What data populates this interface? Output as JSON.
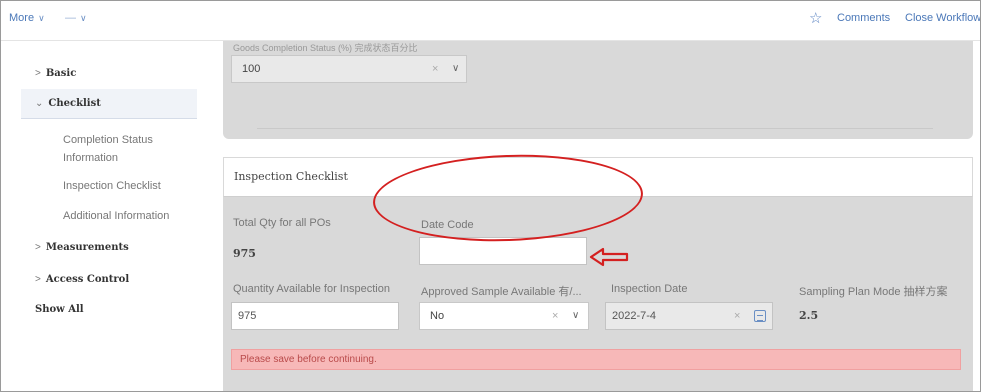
{
  "topbar": {
    "more_label": "More",
    "second_label": "—",
    "comments_label": "Comments",
    "close_workflow_label": "Close Workflow"
  },
  "sidebar": {
    "items": [
      {
        "label": "Basic",
        "arrow": ">"
      },
      {
        "label": "Checklist",
        "arrow": "⌄"
      },
      {
        "label": "Measurements",
        "arrow": ">"
      },
      {
        "label": "Access Control",
        "arrow": ">"
      },
      {
        "label": "Show All",
        "arrow": ""
      }
    ],
    "checklist_subitems": [
      {
        "label": "Completion Status Information"
      },
      {
        "label": "Inspection Checklist"
      },
      {
        "label": "Additional Information"
      }
    ]
  },
  "completion": {
    "faded_label": "Goods Completion Status (%) 完成状态百分比",
    "value": "100"
  },
  "inspection_checklist": {
    "title": "Inspection Checklist",
    "total_qty_label": "Total Qty for all POs",
    "total_qty_value": "975",
    "date_code_label": "Date Code",
    "date_code_value": "",
    "qty_available_label": "Quantity Available for Inspection",
    "qty_available_value": "975",
    "approved_sample_label": "Approved Sample Available 有/...",
    "approved_sample_value": "No",
    "inspection_date_label": "Inspection Date",
    "inspection_date_value": "2022-7-4",
    "sampling_plan_label": "Sampling Plan Mode 抽样方案",
    "sampling_plan_value": "2.5",
    "error_message": "Please save before continuing."
  },
  "icons": {
    "clear": "×",
    "dropdown": "∨",
    "star": "☆"
  },
  "colors": {
    "accent_blue": "#4b78b8",
    "annotation_red": "#d42020",
    "error_bg": "#f7b8b8"
  }
}
